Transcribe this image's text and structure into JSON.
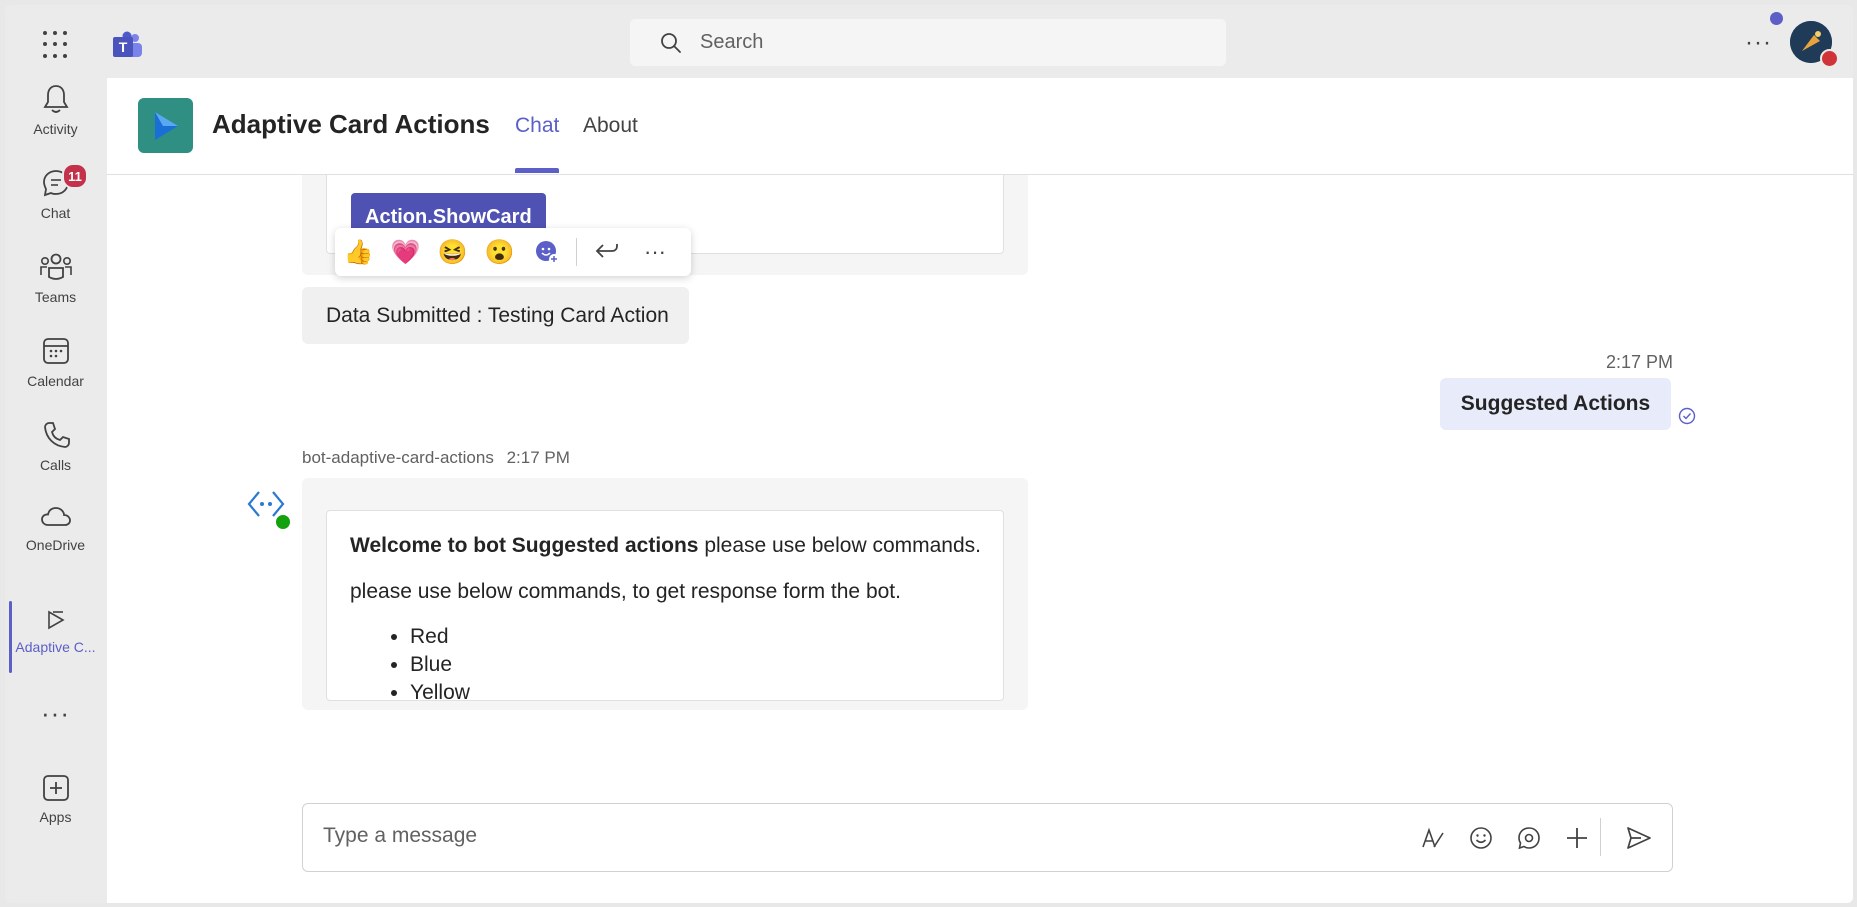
{
  "topbar": {
    "search_placeholder": "Search"
  },
  "rail": {
    "items": [
      {
        "label": "Activity",
        "icon": "bell-icon"
      },
      {
        "label": "Chat",
        "icon": "chat-icon",
        "badge": "11"
      },
      {
        "label": "Teams",
        "icon": "teams-icon"
      },
      {
        "label": "Calendar",
        "icon": "calendar-icon"
      },
      {
        "label": "Calls",
        "icon": "phone-icon"
      },
      {
        "label": "OneDrive",
        "icon": "cloud-icon"
      },
      {
        "label": "Adaptive C...",
        "icon": "adaptive-card-icon",
        "active": true
      },
      {
        "label": "Apps",
        "icon": "add-apps-icon"
      }
    ]
  },
  "header": {
    "title": "Adaptive Card Actions",
    "tabs": [
      {
        "label": "Chat",
        "active": true
      },
      {
        "label": "About",
        "active": false
      }
    ]
  },
  "chat": {
    "showcard_button": "Action.ShowCard",
    "submitted_text": "Data Submitted : Testing Card Action",
    "my_message": {
      "time": "2:17 PM",
      "text": "Suggested Actions"
    },
    "bot_message": {
      "sender": "bot-adaptive-card-actions",
      "time": "2:17 PM",
      "welcome_bold": "Welcome to bot Suggested actions",
      "welcome_rest": " please use below commands.",
      "line2": "please use below commands, to get response form the bot.",
      "commands": [
        "Red",
        "Blue",
        "Yellow"
      ]
    }
  },
  "compose": {
    "placeholder": "Type a message"
  },
  "colors": {
    "accent": "#5b5fc7",
    "button": "#4f52b2",
    "badge": "#c4314b"
  }
}
